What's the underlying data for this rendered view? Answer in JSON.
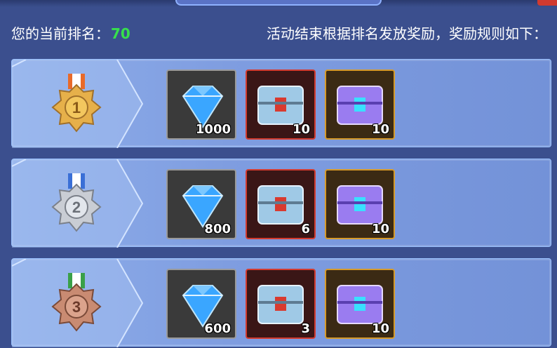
{
  "header": {
    "rank_label": "您的当前排名：",
    "rank_value": "70",
    "rules_text": "活动结束根据排名发放奖励，奖励规则如下："
  },
  "rewards": [
    {
      "rank": "1",
      "medal": "gold-medal",
      "diamonds": "1000",
      "red_chests": "10",
      "purple_chests": "10"
    },
    {
      "rank": "2",
      "medal": "silver-medal",
      "diamonds": "800",
      "red_chests": "6",
      "purple_chests": "10"
    },
    {
      "rank": "3",
      "medal": "bronze-medal",
      "diamonds": "600",
      "red_chests": "3",
      "purple_chests": "10"
    }
  ],
  "colors": {
    "background": "#3b4f8e",
    "rank_value": "#36e04c",
    "diamond_frame": "#9a9a9a",
    "red_frame": "#d33b2f",
    "gold_frame": "#d69a2a",
    "gold_medal": "#e6b04a",
    "silver_medal": "#c9cdd4",
    "bronze_medal": "#c98b72"
  }
}
